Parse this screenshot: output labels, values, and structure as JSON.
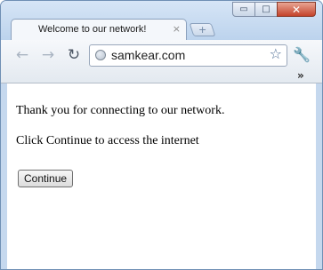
{
  "window": {
    "controls": {
      "minimize": "▭",
      "maximize": "□",
      "close": "✕"
    }
  },
  "tab": {
    "title": "Welcome to our network!",
    "close": "×",
    "new_tab": "+"
  },
  "toolbar": {
    "back": "←",
    "forward": "→",
    "reload": "↻",
    "url": "samkear.com",
    "bookmark": "☆",
    "wrench": "🔧",
    "overflow": "»"
  },
  "page": {
    "message1": "Thank you for connecting to our network.",
    "message2": "Click Continue to access the internet",
    "continue_label": "Continue"
  },
  "colors": {
    "frame": "#c5d8ee",
    "close_button": "#c4422a"
  }
}
